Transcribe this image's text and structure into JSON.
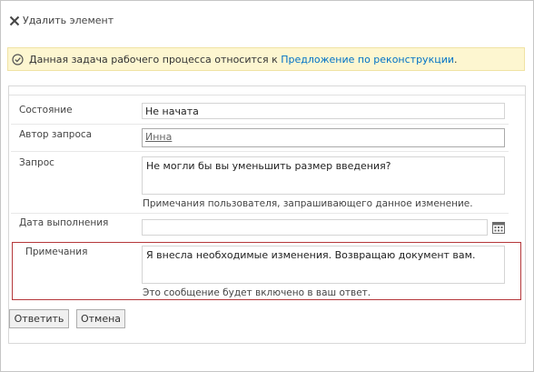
{
  "ribbon": {
    "delete_label": "Удалить элемент"
  },
  "notice": {
    "prefix": "Данная задача рабочего процесса относится к ",
    "link": "Предложение по реконструкции",
    "suffix": "."
  },
  "form": {
    "status": {
      "label": "Состояние",
      "value": "Не начата"
    },
    "requester": {
      "label": "Автор запроса",
      "value": "Инна"
    },
    "request": {
      "label": "Запрос",
      "value": "Не могли бы вы уменьшить размер введения?",
      "description": "Примечания пользователя, запрашивающего данное изменение."
    },
    "due_date": {
      "label": "Дата выполнения",
      "value": ""
    },
    "comments": {
      "label": "Примечания",
      "value": "Я внесла необходимые изменения. Возвращаю документ вам.",
      "description": "Это сообщение будет включено в ваш ответ."
    }
  },
  "buttons": {
    "reply": "Ответить",
    "cancel": "Отмена"
  },
  "colors": {
    "notice_bg": "#fdf6d0",
    "link": "#0072c6",
    "highlight_border": "#b5383b"
  }
}
